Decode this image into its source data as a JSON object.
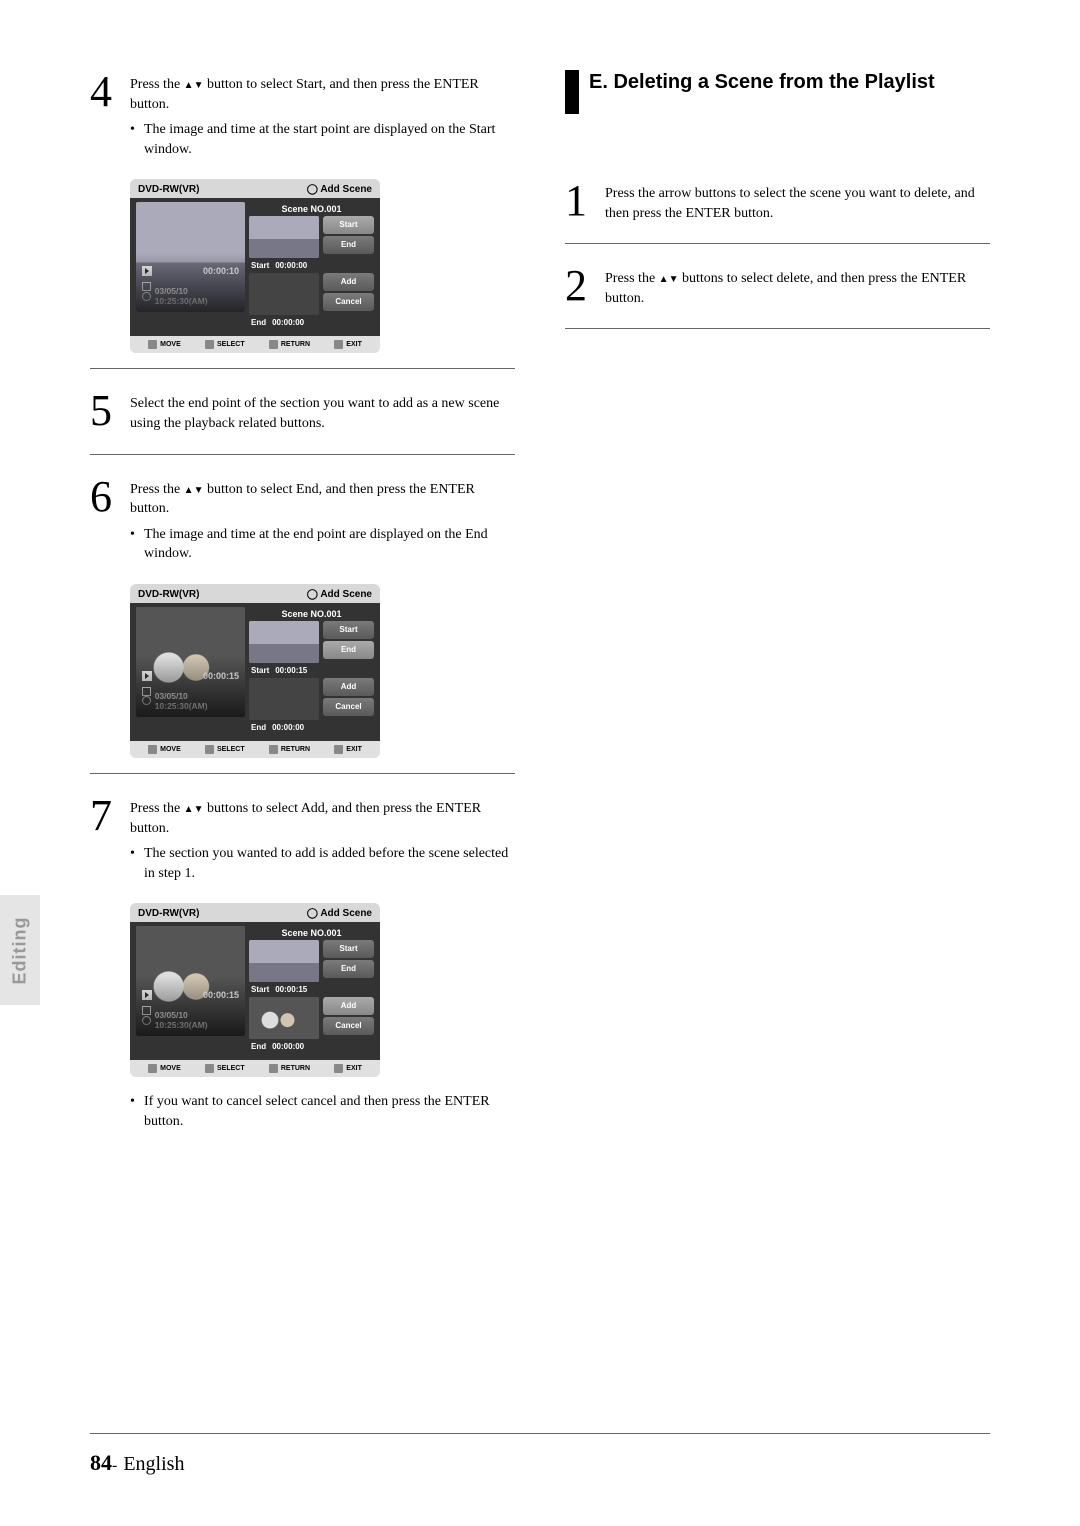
{
  "sideTab": "Editing",
  "footer": {
    "page": "84",
    "sep": " - ",
    "lang": "English"
  },
  "sectionE": {
    "title": "E. Deleting a Scene from the Playlist"
  },
  "steps": {
    "s4": {
      "num": "4",
      "text_a": "Press the ",
      "text_b": " button to select Start, and then press the ENTER button.",
      "bullet": "The image and time at the start point are displayed on the Start window."
    },
    "s5": {
      "num": "5",
      "text": "Select the end point of the section you want to add as a new scene using the playback related buttons."
    },
    "s6": {
      "num": "6",
      "text_a": "Press the ",
      "text_b": " button to select End, and then press the ENTER button.",
      "bullet": "The image and time at the end point are displayed on the End window."
    },
    "s7": {
      "num": "7",
      "text_a": "Press the ",
      "text_b": " buttons to select Add, and then press the ENTER button.",
      "bullet1": "The section you wanted to add is added before the scene selected in step 1.",
      "bullet2": "If you want to cancel select cancel and then press the ENTER button."
    },
    "e1": {
      "num": "1",
      "text": "Press the arrow buttons to select the scene you want to delete, and then press the ENTER button."
    },
    "e2": {
      "num": "2",
      "text_a": "Press the ",
      "text_b": " buttons to select delete, and then press the ENTER button."
    }
  },
  "shot": {
    "head_left": "DVD-RW(VR)",
    "head_right": "Add Scene",
    "scene": "Scene NO.001",
    "btn_start": "Start",
    "btn_end": "End",
    "btn_add": "Add",
    "btn_cancel": "Cancel",
    "lbl_start": "Start",
    "lbl_end": "End",
    "foot_move": "MOVE",
    "foot_select": "SELECT",
    "foot_return": "RETURN",
    "foot_exit": "EXIT",
    "date": "03/05/10 10:25:30(AM)",
    "a": {
      "time_main": "00:00:10",
      "time_start": "00:00:00",
      "time_end": "00:00:00",
      "highlight": "start"
    },
    "b": {
      "time_main": "00:00:15",
      "time_start": "00:00:15",
      "time_end": "00:00:00",
      "highlight": "end"
    },
    "c": {
      "time_main": "00:00:15",
      "time_start": "00:00:15",
      "time_end": "00:00:00",
      "highlight": "add"
    }
  }
}
